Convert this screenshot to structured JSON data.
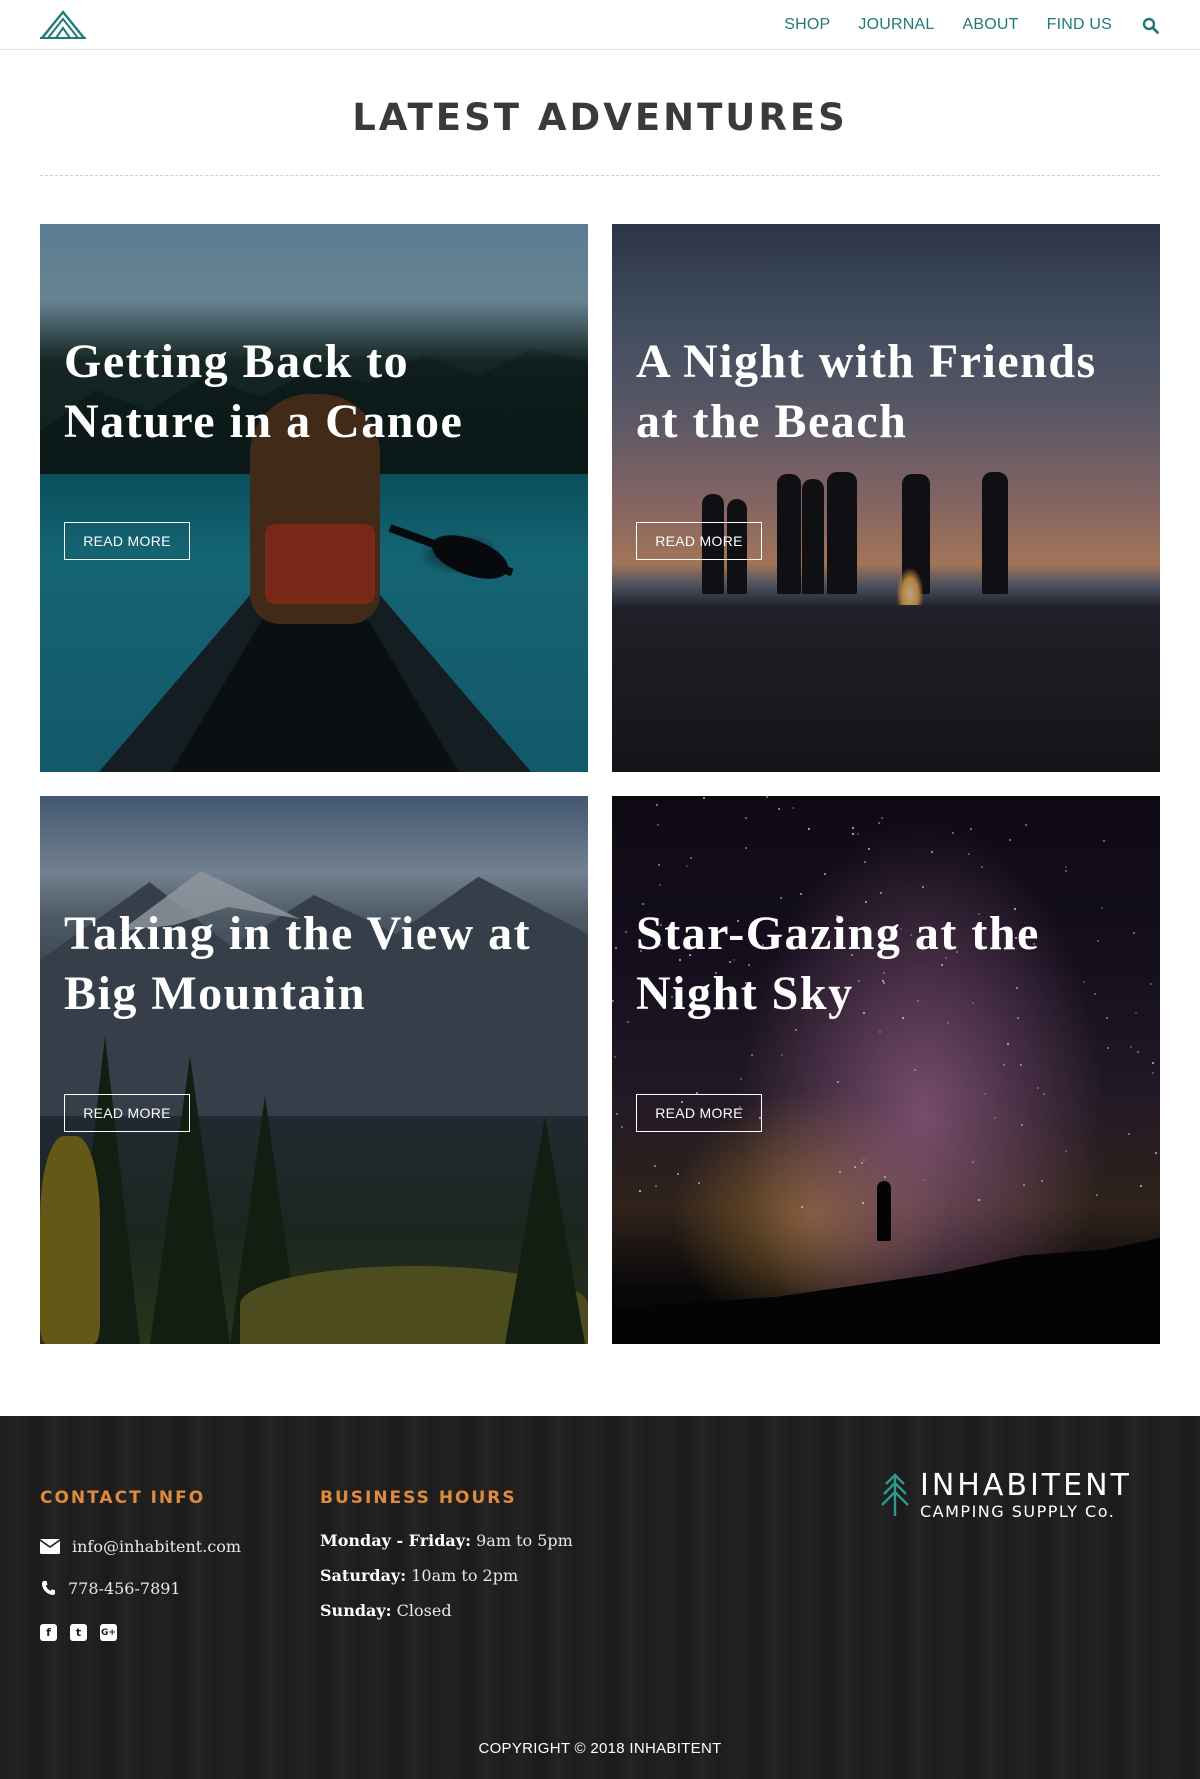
{
  "header": {
    "nav": [
      {
        "label": "SHOP",
        "name": "nav-shop"
      },
      {
        "label": "JOURNAL",
        "name": "nav-journal"
      },
      {
        "label": "ABOUT",
        "name": "nav-about"
      },
      {
        "label": "FIND US",
        "name": "nav-find-us"
      }
    ],
    "search_icon": "search-icon",
    "logo_icon": "tent-logo-icon",
    "accent_color": "#1f7a78"
  },
  "main": {
    "title": "LATEST ADVENTURES",
    "cards": [
      {
        "title": "Getting Back to Nature in a Canoe",
        "button": "READ MORE"
      },
      {
        "title": "A Night with Friends at the Beach",
        "button": "READ MORE"
      },
      {
        "title": "Taking in the View at Big Mountain",
        "button": "READ MORE"
      },
      {
        "title": "Star-Gazing at the Night Sky",
        "button": "READ MORE"
      }
    ]
  },
  "footer": {
    "contact": {
      "heading": "CONTACT INFO",
      "email": "info@inhabitent.com",
      "phone": "778-456-7891",
      "social_icons": [
        "facebook-icon",
        "twitter-icon",
        "google-plus-icon"
      ]
    },
    "hours": {
      "heading": "BUSINESS HOURS",
      "rows": [
        {
          "day": "Monday - Friday:",
          "time": "9am to 5pm"
        },
        {
          "day": "Saturday:",
          "time": "10am to 2pm"
        },
        {
          "day": "Sunday:",
          "time": "Closed"
        }
      ]
    },
    "brand": {
      "name": "INHABITENT",
      "subtitle": "CAMPING SUPPLY Co."
    },
    "copyright": "COPYRIGHT © 2018 INHABITENT",
    "heading_color": "#e08a3c"
  }
}
